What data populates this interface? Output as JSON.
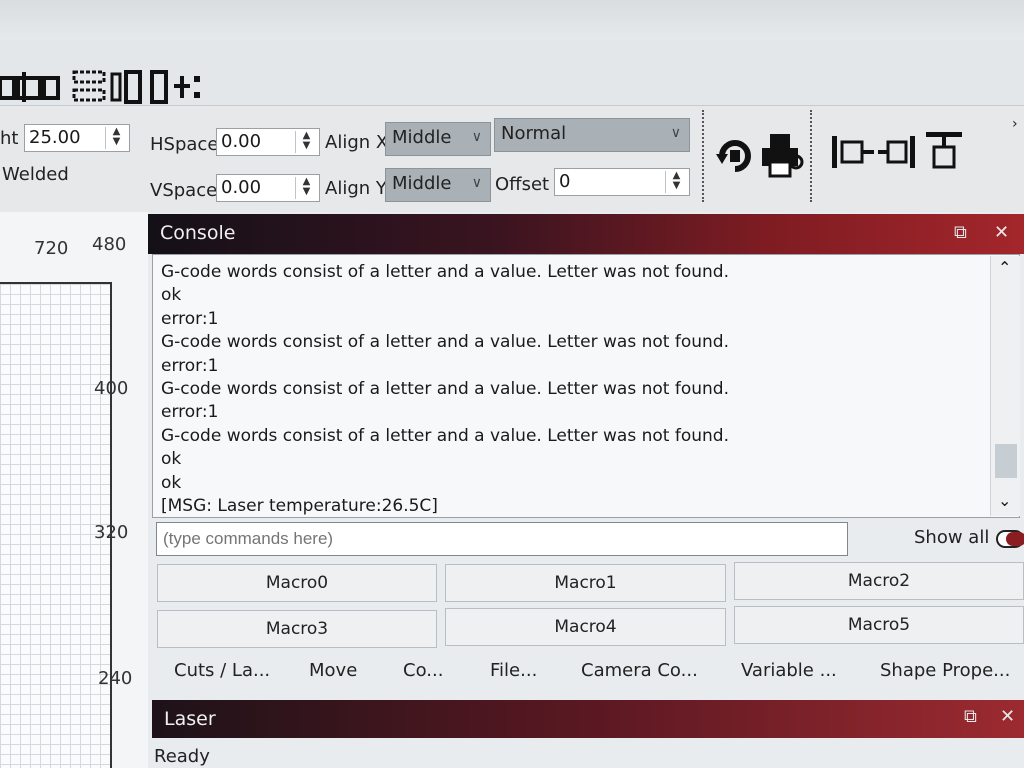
{
  "toolbar": {
    "height_label": "ht",
    "height_value": "25.00",
    "welded_label": "Welded",
    "hspace_label": "HSpace",
    "hspace_value": "0.00",
    "vspace_label": "VSpace",
    "vspace_value": "0.00",
    "alignx_label": "Align X",
    "alignx_value": "Middle",
    "aligny_label": "Align Y",
    "aligny_value": "Middle",
    "mode_value": "Normal",
    "offset_label": "Offset",
    "offset_value": "0",
    "more_glyph": "›"
  },
  "ruler": {
    "top_left": "720",
    "top_right": "480",
    "v400": "400",
    "v320": "320",
    "v240": "240"
  },
  "console": {
    "title": "Console",
    "lines": [
      "G-code words consist of a letter and a value. Letter was not found.",
      "ok",
      "error:1",
      "G-code words consist of a letter and a value. Letter was not found.",
      "error:1",
      "G-code words consist of a letter and a value. Letter was not found.",
      "error:1",
      "G-code words consist of a letter and a value. Letter was not found.",
      "ok",
      "ok",
      "[MSG: Laser temperature:26.5C]"
    ],
    "input_placeholder": "(type commands here)",
    "show_all_label": "Show all"
  },
  "macros": [
    "Macro0",
    "Macro1",
    "Macro2",
    "Macro3",
    "Macro4",
    "Macro5"
  ],
  "tabs": [
    "Cuts / La...",
    "Move",
    "Co...",
    "File...",
    "Camera Co...",
    "Variable ...",
    "Shape Prope..."
  ],
  "laser": {
    "title": "Laser",
    "status": "Ready"
  },
  "window_buttons": {
    "restore": "⧉",
    "close": "✕"
  }
}
